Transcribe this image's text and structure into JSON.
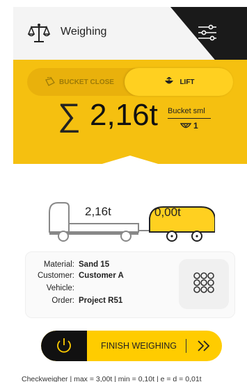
{
  "header": {
    "title": "Weighing",
    "icon": "scale-icon",
    "settings_icon": "sliders-icon"
  },
  "mode_toggle": {
    "left_label": "BUCKET CLOSE",
    "right_label": "LIFT",
    "selected": "LIFT"
  },
  "summary": {
    "sigma": "∑",
    "total": "2,16t",
    "bucket_label": "Bucket sml",
    "bucket_count": "1"
  },
  "vehicle": {
    "truck_weight": "2,16t",
    "trailer_weight": "0,00t"
  },
  "info": {
    "rows": [
      {
        "label": "Material:",
        "value": "Sand 15"
      },
      {
        "label": "Customer:",
        "value": "Customer A"
      },
      {
        "label": "Vehicle:",
        "value": ""
      },
      {
        "label": "Order:",
        "value": "Project R51"
      }
    ],
    "grid_icon": "keypad-icon"
  },
  "actions": {
    "finish_label": "FINISH WEIGHING",
    "power_icon": "power-icon",
    "next_icon": "double-chevron-right-icon"
  },
  "footer": {
    "text": "Checkweigher | max = 3,00t | min = 0,10t | e = d = 0,01t"
  },
  "colors": {
    "accent": "#f5c010",
    "dark": "#1a1a1a"
  }
}
